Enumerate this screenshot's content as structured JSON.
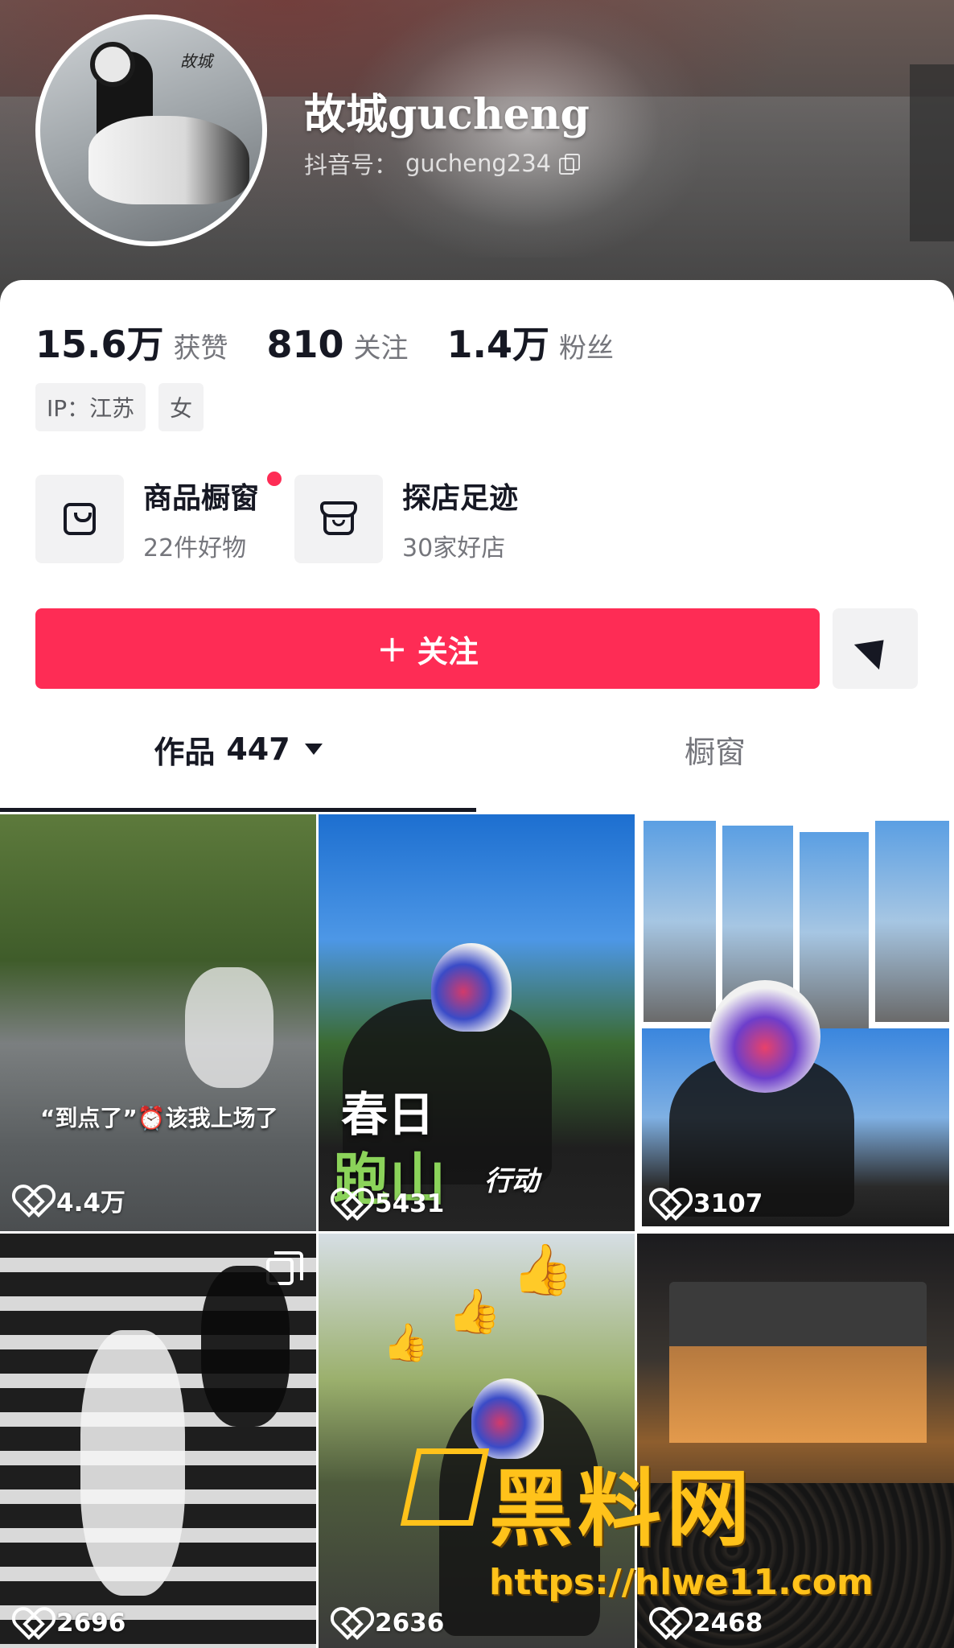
{
  "profile": {
    "nickname": "故城gucheng",
    "douyin_id_label": "抖音号：",
    "douyin_id": "gucheng234",
    "avatar_mark": "故城"
  },
  "stats": [
    {
      "num": "15.6万",
      "label": "获赞"
    },
    {
      "num": "810",
      "label": "关注"
    },
    {
      "num": "1.4万",
      "label": "粉丝"
    }
  ],
  "tags": [
    "IP：江苏",
    "女"
  ],
  "cards": {
    "showcase": {
      "title": "商品橱窗",
      "sub": "22件好物",
      "icon": "shopping-bag-icon",
      "has_dot": true
    },
    "explore": {
      "title": "探店足迹",
      "sub": "30家好店",
      "icon": "store-icon"
    }
  },
  "actions": {
    "follow_plus": "+",
    "follow_label": "关注",
    "share_icon": "send-icon"
  },
  "tabs": {
    "works_label": "作品",
    "works_count": "447",
    "window_label": "橱窗"
  },
  "videos": [
    {
      "likes": "4.4万",
      "caption": "“到点了”⏰该我上场了"
    },
    {
      "likes": "5431",
      "title_line1": "春日",
      "title_line2": "跑山",
      "title_small": "行动"
    },
    {
      "likes": "3107"
    },
    {
      "likes": "2696"
    },
    {
      "likes": "2636"
    },
    {
      "likes": "2468"
    }
  ],
  "watermark": {
    "text": "黑料网",
    "url": "https://hlwe11.com"
  },
  "colors": {
    "accent": "#fe2c55",
    "text_primary": "#161823",
    "text_secondary": "#75767c",
    "chip_bg": "#f2f2f3",
    "watermark": "#ffc21a"
  }
}
